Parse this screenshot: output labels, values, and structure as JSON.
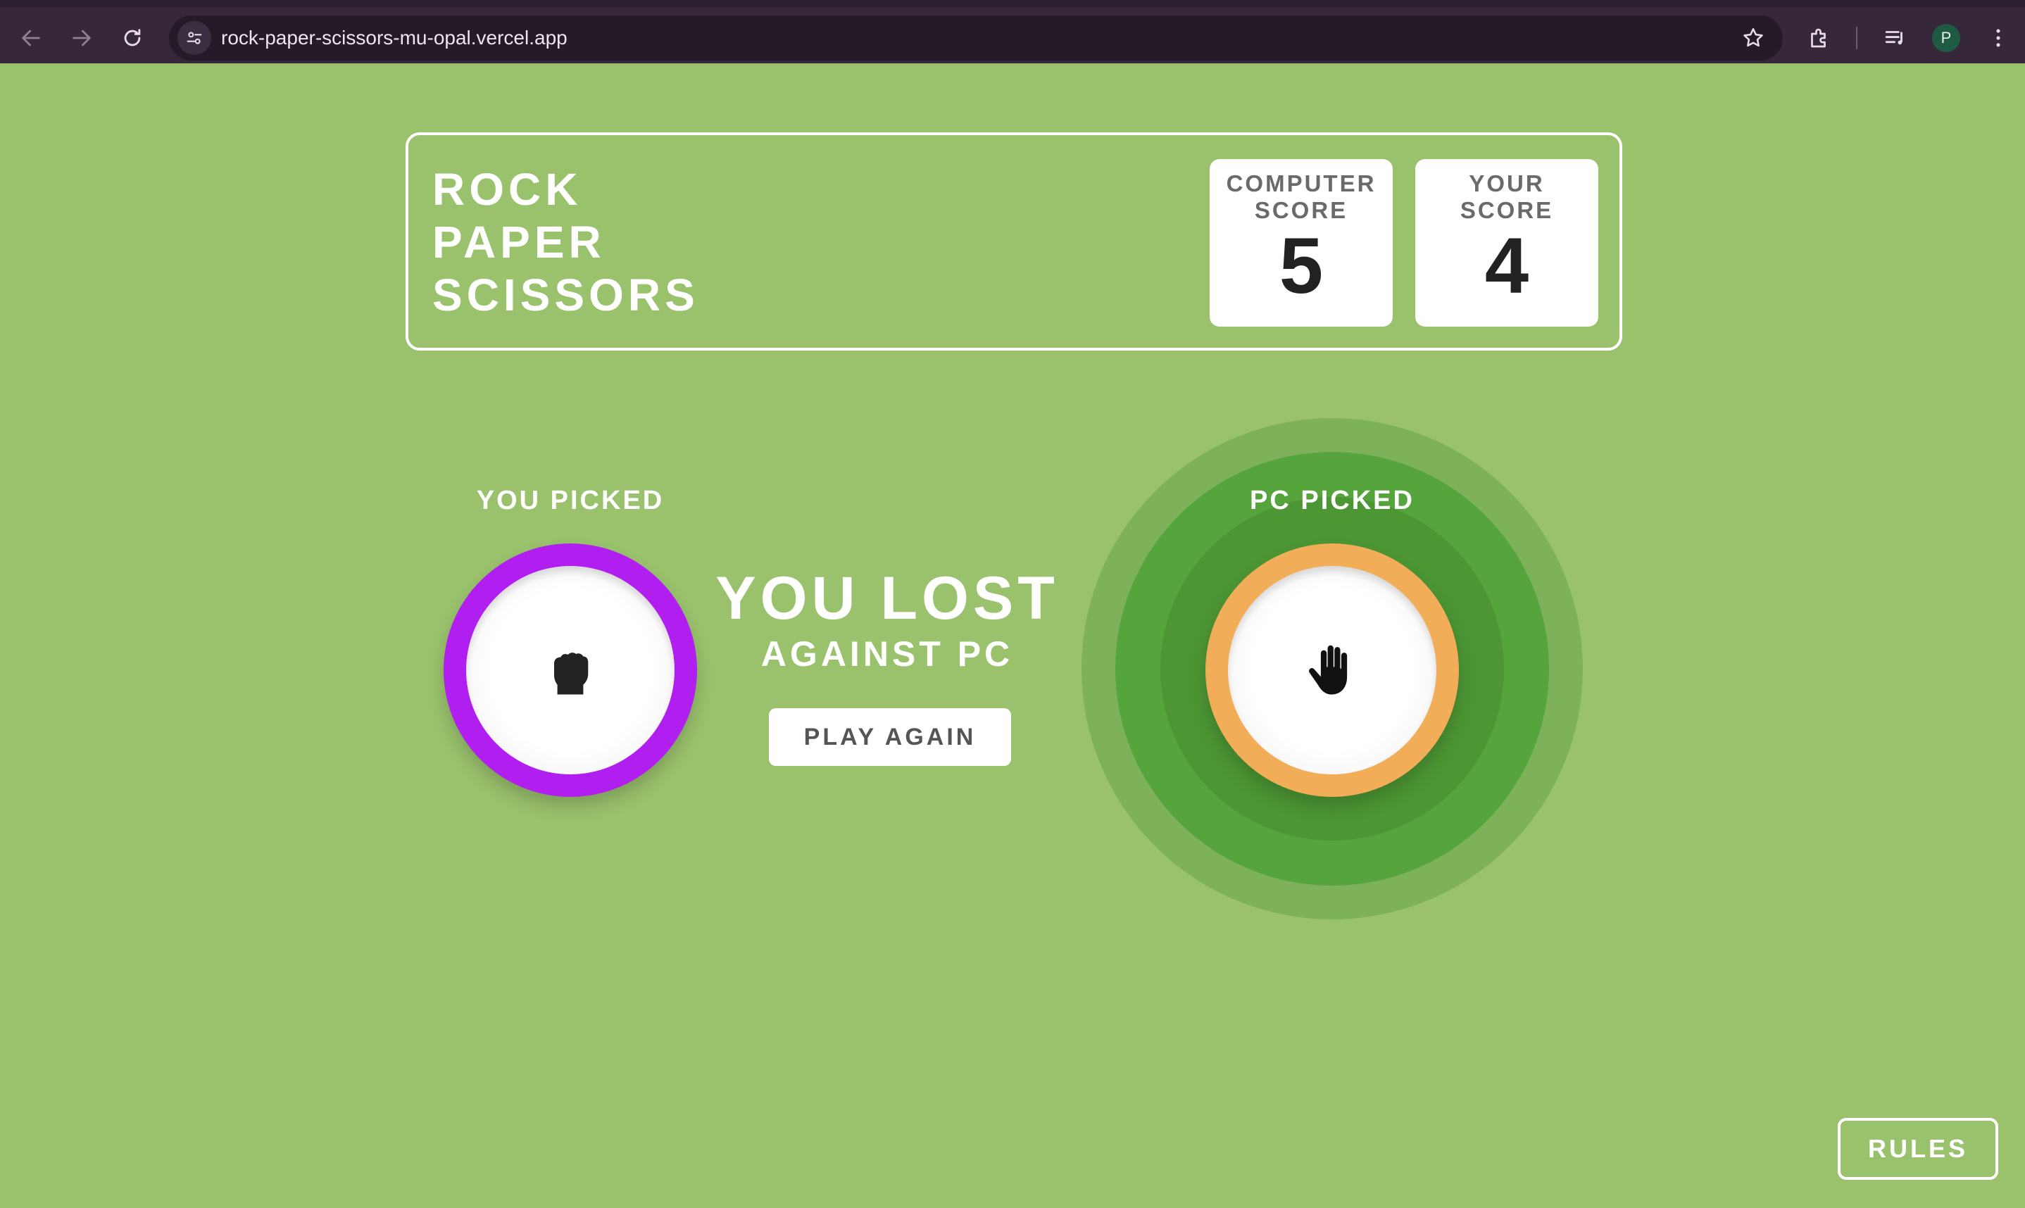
{
  "browser": {
    "url": "rock-paper-scissors-mu-opal.vercel.app",
    "profile_initial": "P",
    "icons": [
      "back-icon",
      "forward-icon",
      "reload-icon",
      "site-info-icon",
      "bookmark-star-icon",
      "extensions-icon",
      "media-control-icon",
      "profile-avatar",
      "menu-icon"
    ]
  },
  "header": {
    "title_lines": [
      "ROCK",
      "PAPER",
      "SCISSORS"
    ],
    "computer_score": {
      "label_lines": [
        "COMPUTER",
        "SCORE"
      ],
      "value": "5"
    },
    "your_score": {
      "label_lines": [
        "YOUR",
        "SCORE"
      ],
      "value": "4"
    }
  },
  "result": {
    "you_picked_label": "YOU PICKED",
    "pc_picked_label": "PC PICKED",
    "title": "YOU LOST",
    "subtitle": "AGAINST PC",
    "play_again_label": "PLAY AGAIN",
    "you_choice": {
      "name": "rock",
      "icon": "fist-icon",
      "ring_color": "#b01ff0"
    },
    "pc_choice": {
      "name": "paper",
      "icon": "hand-icon",
      "ring_color": "#f2ad58"
    },
    "winner": "pc"
  },
  "rules_label": "RULES",
  "colors": {
    "background": "#9ac26d",
    "winner_halo": [
      "#7db25a",
      "#56a53c",
      "#4c9634"
    ]
  }
}
